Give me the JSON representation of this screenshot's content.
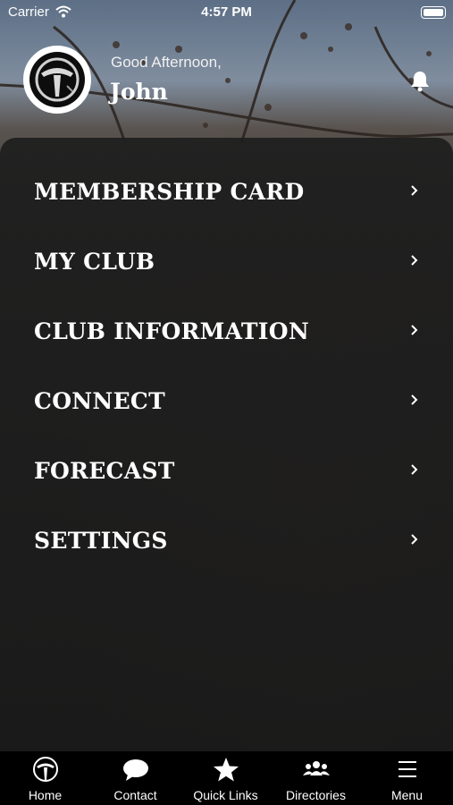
{
  "status_bar": {
    "carrier": "Carrier",
    "time": "4:57 PM"
  },
  "header": {
    "greeting": "Good Afternoon,",
    "name": "John"
  },
  "menu": [
    {
      "label": "MEMBERSHIP CARD"
    },
    {
      "label": "MY CLUB"
    },
    {
      "label": "CLUB INFORMATION"
    },
    {
      "label": "CONNECT"
    },
    {
      "label": "FORECAST"
    },
    {
      "label": "SETTINGS"
    }
  ],
  "tabbar": [
    {
      "label": "Home",
      "icon": "club-logo-icon"
    },
    {
      "label": "Contact",
      "icon": "chat-bubble-icon"
    },
    {
      "label": "Quick Links",
      "icon": "star-icon"
    },
    {
      "label": "Directories",
      "icon": "group-icon"
    },
    {
      "label": "Menu",
      "icon": "hamburger-icon"
    }
  ]
}
